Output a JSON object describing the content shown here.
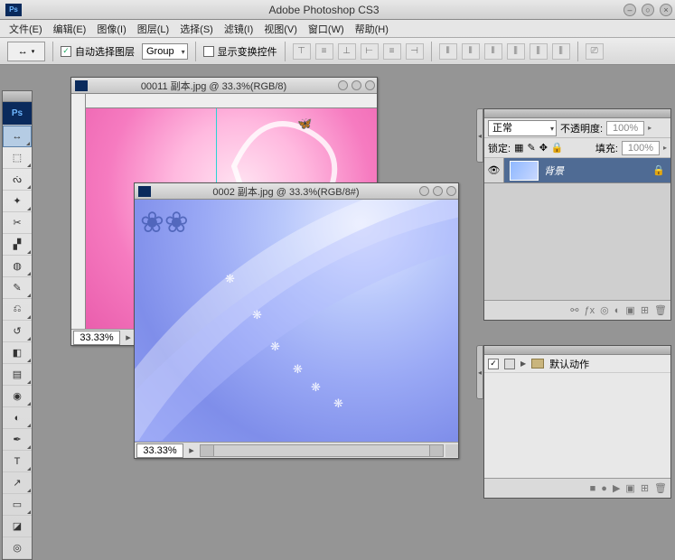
{
  "app": {
    "title": "Adobe Photoshop CS3",
    "logo": "Ps"
  },
  "windowButtons": {
    "min": "–",
    "max": "○",
    "close": "×"
  },
  "menu": {
    "file": "文件(E)",
    "edit": "编辑(E)",
    "image": "图像(I)",
    "layer": "图层(L)",
    "select": "选择(S)",
    "filter": "滤镜(I)",
    "view": "视图(V)",
    "window": "窗口(W)",
    "help": "帮助(H)"
  },
  "options": {
    "autoSelect": "自动选择图层",
    "groupSelect": "Group",
    "showTransform": "显示变换控件"
  },
  "documents": {
    "doc1": {
      "title": "00011 副本.jpg @ 33.3%(RGB/8)",
      "zoom": "33.33%"
    },
    "doc2": {
      "title": "0002 副本.jpg @ 33.3%(RGB/8#)",
      "zoom": "33.33%"
    }
  },
  "layersPanel": {
    "mode": "正常",
    "opacityLabel": "不透明度:",
    "opacityVal": "100%",
    "lockLabel": "锁定:",
    "fillLabel": "填充:",
    "fillVal": "100%",
    "layer1": "背景"
  },
  "actionsPanel": {
    "folder": "默认动作"
  },
  "tools": {
    "ps": "Ps",
    "move": "↔",
    "marquee": "⬚",
    "lasso": "ᔔ",
    "wand": "✦",
    "crop": "✂",
    "slice": "▞",
    "heal": "◍",
    "brush": "✎",
    "stamp": "⎌",
    "history": "↺",
    "eraser": "◧",
    "gradient": "▤",
    "blur": "◉",
    "dodge": "◐",
    "pen": "✒",
    "type": "T",
    "path": "↗",
    "shape": "▭",
    "swatch": "◪",
    "mask": "◎"
  }
}
